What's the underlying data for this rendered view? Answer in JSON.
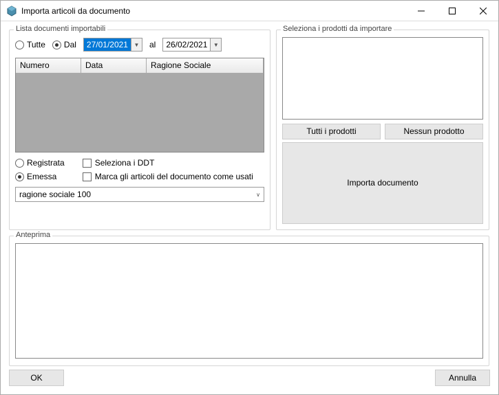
{
  "window": {
    "title": "Importa articoli da documento"
  },
  "docs": {
    "legend": "Lista documenti importabili",
    "filter_all": "Tutte",
    "filter_from": "Dal",
    "filter_to": "al",
    "date_from": "27/01/2021",
    "date_to": "26/02/2021",
    "col_number": "Numero",
    "col_date": "Data",
    "col_company": "Ragione Sociale",
    "state_registered": "Registrata",
    "state_issued": "Emessa",
    "chk_select_ddt": "Seleziona i DDT",
    "chk_mark_used": "Marca gli articoli del documento come usati",
    "company_combo": "ragione sociale 100"
  },
  "prod": {
    "legend": "Seleziona i prodotti da importare",
    "btn_all": "Tutti i prodotti",
    "btn_none": "Nessun prodotto",
    "btn_import": "Importa documento"
  },
  "preview": {
    "legend": "Anteprima"
  },
  "buttons": {
    "ok": "OK",
    "cancel": "Annulla"
  }
}
